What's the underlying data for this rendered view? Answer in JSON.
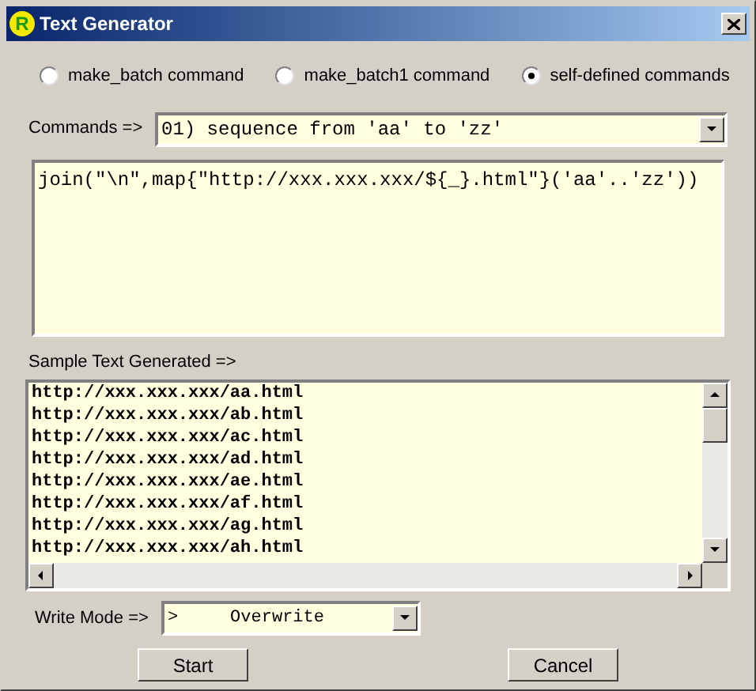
{
  "window": {
    "title": "Text Generator",
    "icon_letter": "R"
  },
  "modes": [
    {
      "label": "make_batch command",
      "selected": false
    },
    {
      "label": "make_batch1 command",
      "selected": false
    },
    {
      "label": "self-defined commands",
      "selected": true
    }
  ],
  "commands": {
    "label": "Commands =>",
    "value": "01) sequence from 'aa' to 'zz'"
  },
  "expression": {
    "value": "join(\"\\n\",map{\"http://xxx.xxx.xxx/${_}.html\"}('aa'..'zz'))"
  },
  "sample": {
    "label": "Sample Text Generated =>",
    "lines": [
      "http://xxx.xxx.xxx/aa.html",
      "http://xxx.xxx.xxx/ab.html",
      "http://xxx.xxx.xxx/ac.html",
      "http://xxx.xxx.xxx/ad.html",
      "http://xxx.xxx.xxx/ae.html",
      "http://xxx.xxx.xxx/af.html",
      "http://xxx.xxx.xxx/ag.html",
      "http://xxx.xxx.xxx/ah.html"
    ]
  },
  "write_mode": {
    "label": "Write Mode =>",
    "value": ">     Overwrite"
  },
  "buttons": [
    "Start",
    "Cancel"
  ]
}
